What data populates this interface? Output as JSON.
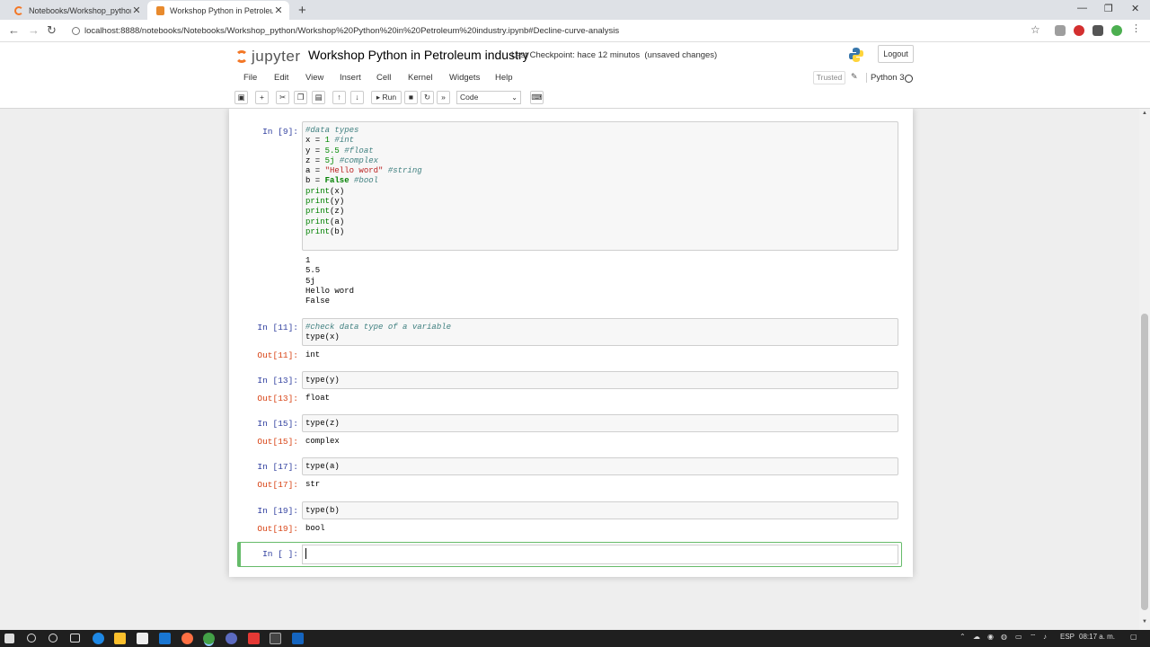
{
  "browser": {
    "tabs": [
      {
        "title": "Notebooks/Workshop_python/",
        "close": "✕"
      },
      {
        "title": "Workshop Python in Petroleum industr",
        "close": "✕"
      }
    ],
    "new_tab": "+",
    "window_controls": {
      "minimize": "—",
      "restore": "❐",
      "close": "✕"
    },
    "url": "localhost:8888/notebooks/Notebooks/Workshop_python/Workshop%20Python%20in%20Petroleum%20industry.ipynb#Decline-curve-analysis",
    "nav": {
      "back": "←",
      "forward": "→",
      "reload": "↻"
    },
    "star": "☆"
  },
  "jupyter": {
    "logo_text": "jupyter",
    "notebook_name": "Workshop Python in Petroleum industry",
    "checkpoint": "Last Checkpoint: hace 12 minutos",
    "unsaved": "(unsaved changes)",
    "logout": "Logout",
    "menu": [
      "File",
      "Edit",
      "View",
      "Insert",
      "Cell",
      "Kernel",
      "Widgets",
      "Help"
    ],
    "trusted": "Trusted",
    "kernel": "Python 3",
    "toolbar": {
      "run": "Run",
      "cell_type": "Code"
    }
  },
  "cells": {
    "c9": {
      "prompt": "In [9]:",
      "lines": [
        {
          "comment": "#data types"
        },
        {
          "code": "x = ",
          "num": "1",
          "comment": " #int"
        },
        {
          "code": "y = ",
          "num": "5.5",
          "comment": " #float"
        },
        {
          "code": "z = ",
          "num": "5j",
          "comment": " #complex"
        },
        {
          "code": "a = ",
          "str": "\"Hello word\"",
          "comment": " #string"
        },
        {
          "code": "b = ",
          "kw": "False",
          "comment": " #bool"
        },
        {
          "bi": "print",
          "code": "(x)"
        },
        {
          "bi": "print",
          "code": "(y)"
        },
        {
          "bi": "print",
          "code": "(z)"
        },
        {
          "bi": "print",
          "code": "(a)"
        },
        {
          "bi": "print",
          "code": "(b)"
        }
      ],
      "output": [
        "1",
        "5.5",
        "5j",
        "Hello word",
        "False"
      ]
    },
    "c11": {
      "prompt": "In [11]:",
      "comment": "#check data type of a variable",
      "code": "type(x)",
      "out_prompt": "Out[11]:",
      "output": "int"
    },
    "c13": {
      "prompt": "In [13]:",
      "code": "type(y)",
      "out_prompt": "Out[13]:",
      "output": "float"
    },
    "c15": {
      "prompt": "In [15]:",
      "code": "type(z)",
      "out_prompt": "Out[15]:",
      "output": "complex"
    },
    "c17": {
      "prompt": "In [17]:",
      "code": "type(a)",
      "out_prompt": "Out[17]:",
      "output": "str"
    },
    "c19": {
      "prompt": "In [19]:",
      "code": "type(b)",
      "out_prompt": "Out[19]:",
      "output": "bool"
    },
    "empty": {
      "prompt": "In [ ]:"
    }
  },
  "taskbar": {
    "lang": "ESP",
    "time": "08:17 a. m."
  }
}
